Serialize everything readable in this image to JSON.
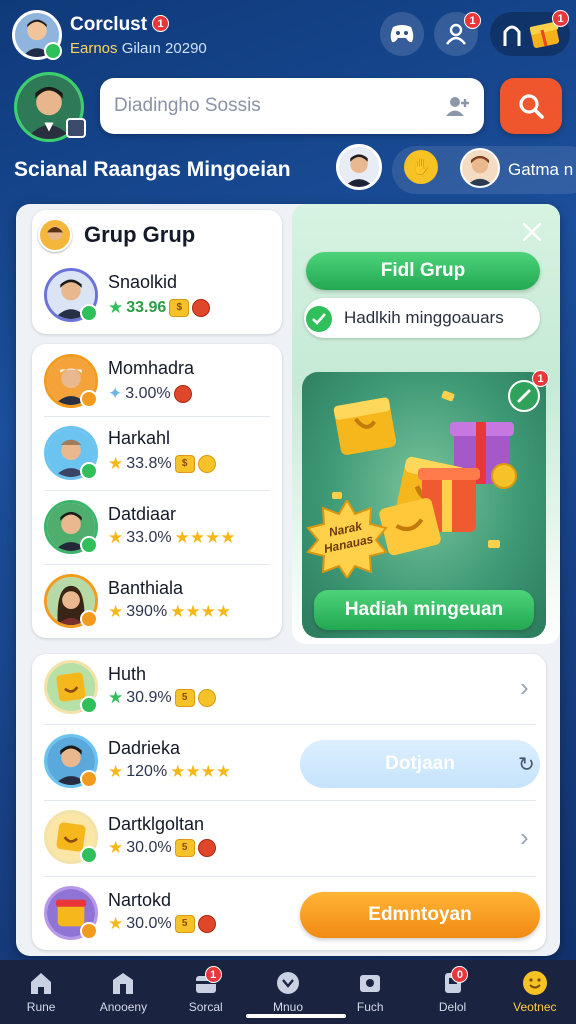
{
  "header": {
    "user_name": "Corclust",
    "user_subtitle_a": "Earnos",
    "user_subtitle_b": "Gilaın 20290",
    "notif_count_name": "1",
    "notif_count_bell": "1",
    "notif_count_gift": "1"
  },
  "search": {
    "placeholder": "Diadingho Sossis"
  },
  "section": {
    "title": "Scianal Raangas Mingoeian",
    "top_chip_label": "Gatma n"
  },
  "group_panel": {
    "title": "Grup Grup",
    "top_member": {
      "name": "Snaolkid",
      "pct": "33.96"
    },
    "members": [
      {
        "name": "Momhadra",
        "pct": "3.00%"
      },
      {
        "name": "Harkahl",
        "pct": "33.8%"
      },
      {
        "name": "Datdiaar",
        "pct": "33.0%"
      },
      {
        "name": "Banthiala",
        "pct": "390%"
      }
    ]
  },
  "right_panel": {
    "find_group_button": "Fidl Grup",
    "weekly_reward_chip": "Hadlkih minggoauars",
    "reward_card_badge": "1",
    "starburst_text": "Narak Hanauas",
    "reward_button": "Hadiah mingeuan"
  },
  "list": [
    {
      "name": "Huth",
      "pct": "30.9%",
      "coin_num": "5",
      "action": "chevron"
    },
    {
      "name": "Dadrieka",
      "pct": "120%",
      "action": "Dotjaan"
    },
    {
      "name": "Dartklgoltan",
      "pct": "30.0%",
      "coin_num": "5",
      "action": "chevron"
    },
    {
      "name": "Nartokd",
      "pct": "30.0%",
      "coin_num": "5",
      "action": "Edmntoyan"
    }
  ],
  "bottom_nav": [
    {
      "label": "Rune",
      "badge": ""
    },
    {
      "label": "Anooeny",
      "badge": ""
    },
    {
      "label": "Sorcal",
      "badge": "1"
    },
    {
      "label": "Mnuo",
      "badge": ""
    },
    {
      "label": "Fuch",
      "badge": ""
    },
    {
      "label": "Delol",
      "badge": "0"
    },
    {
      "label": "Veotnec",
      "badge": ""
    }
  ],
  "colors": {
    "background": "#1c4f9c",
    "accent_orange": "#f0562e",
    "accent_green": "#2fbf5b",
    "nav_active": "#ffce3a"
  }
}
